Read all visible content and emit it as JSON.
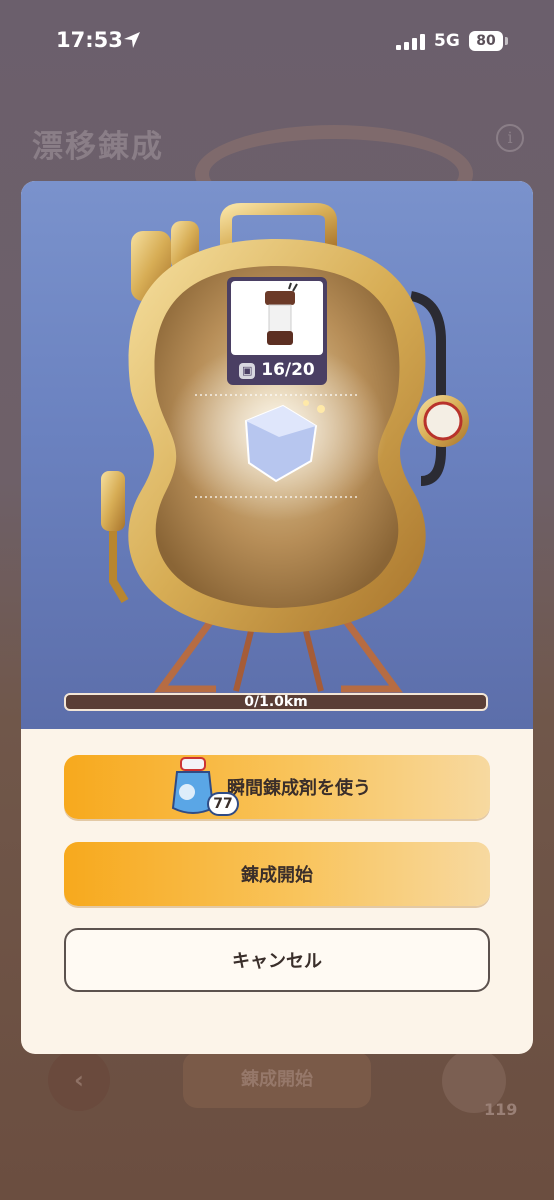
{
  "status_bar": {
    "time": "17:53",
    "network": "5G",
    "battery": "80"
  },
  "background": {
    "title": "漂移錬成",
    "info_icon": "i",
    "back_icon": "‹",
    "start_label": "錬成開始",
    "fab_count": "119"
  },
  "modal": {
    "item": {
      "count": "16/20",
      "count_icon": "material-icon"
    },
    "progress": {
      "label": "0/1.0km",
      "value": 0
    },
    "buttons": {
      "use_booster": "瞬間錬成剤を使う",
      "booster_count": "77",
      "start": "錬成開始",
      "cancel": "キャンセル"
    }
  },
  "colors": {
    "accent": "#f7a91d",
    "hero_bg": "#6b82c0",
    "card": "#fcf4e9"
  }
}
